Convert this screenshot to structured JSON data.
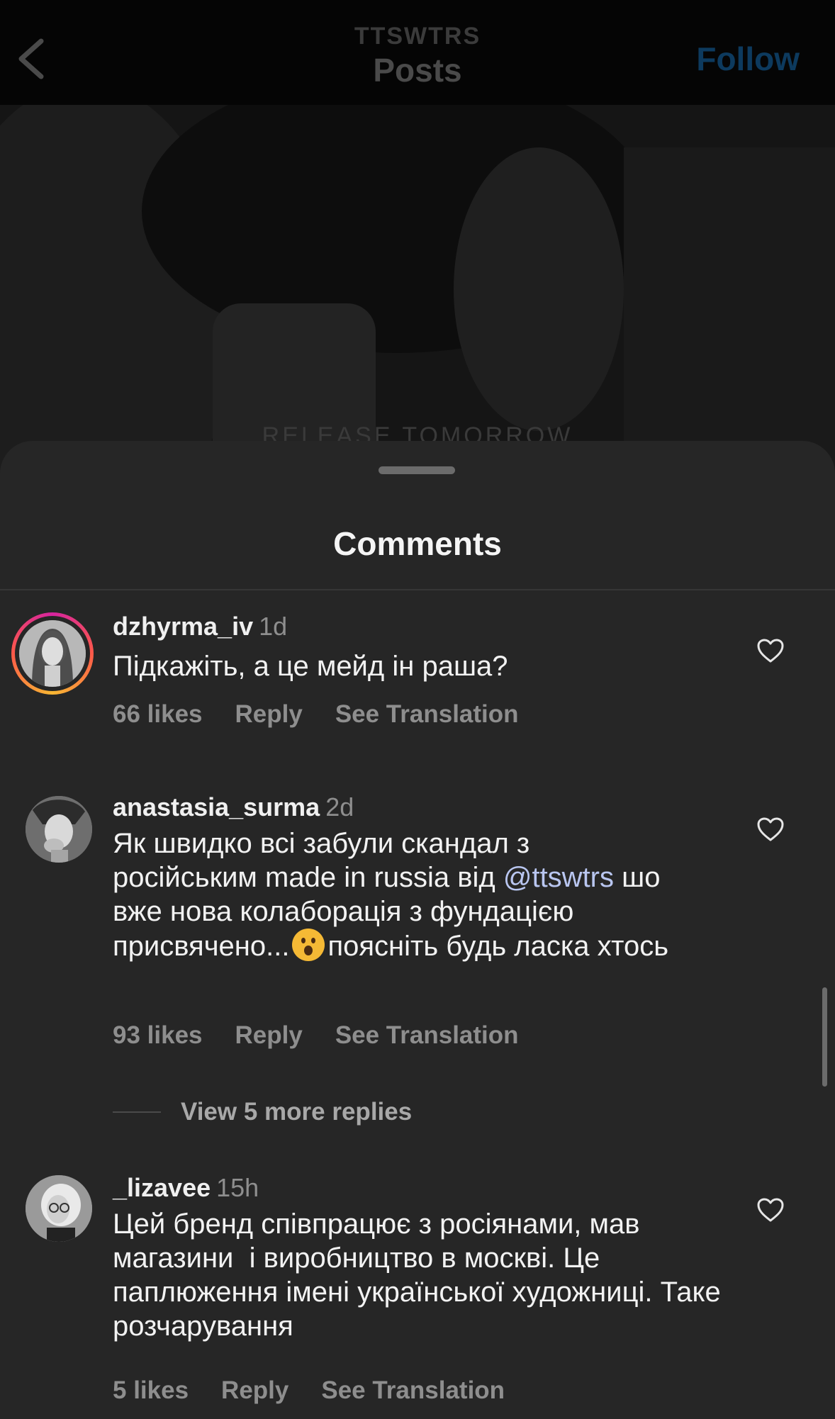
{
  "header": {
    "account": "TTSWTRS",
    "title": "Posts",
    "follow_label": "Follow"
  },
  "post": {
    "caption": "RELEASE TOMORROW"
  },
  "sheet": {
    "title": "Comments"
  },
  "comments": [
    {
      "username": "dzhyrma_iv",
      "time": "1d",
      "text": "Підкажіть, а це мейд ін раша?",
      "likes": "66 likes",
      "reply": "Reply",
      "translate": "See Translation",
      "has_story_ring": true
    },
    {
      "username": "anastasia_surma",
      "time": "2d",
      "text_part1": "Як швидко всі забули скандал з російським made in russia від ",
      "mention": "@ttswtrs",
      "text_part2": " шо вже нова колаборація з фундацією присвячено...",
      "text_part3": "поясніть будь ласка хтось",
      "likes": "93 likes",
      "reply": "Reply",
      "translate": "See Translation",
      "view_replies": "View 5 more replies"
    },
    {
      "username": "_lizavee",
      "time": "15h",
      "text": "Цей бренд співпрацює з росіянами, мав магазини  і виробництво в москві. Це паплюження імені української художниці. Таке розчарування",
      "likes": "5 likes",
      "reply": "Reply",
      "translate": "See Translation"
    }
  ],
  "icons": {
    "back": "chevron-left-icon",
    "like": "heart-outline-icon",
    "emoji": "hushed-face-emoji"
  },
  "colors": {
    "sheet_bg": "#262626",
    "header_bg": "#050505",
    "follow": "#0d3a5e",
    "muted": "#8e8e8e",
    "mention": "#b9c6f0"
  }
}
